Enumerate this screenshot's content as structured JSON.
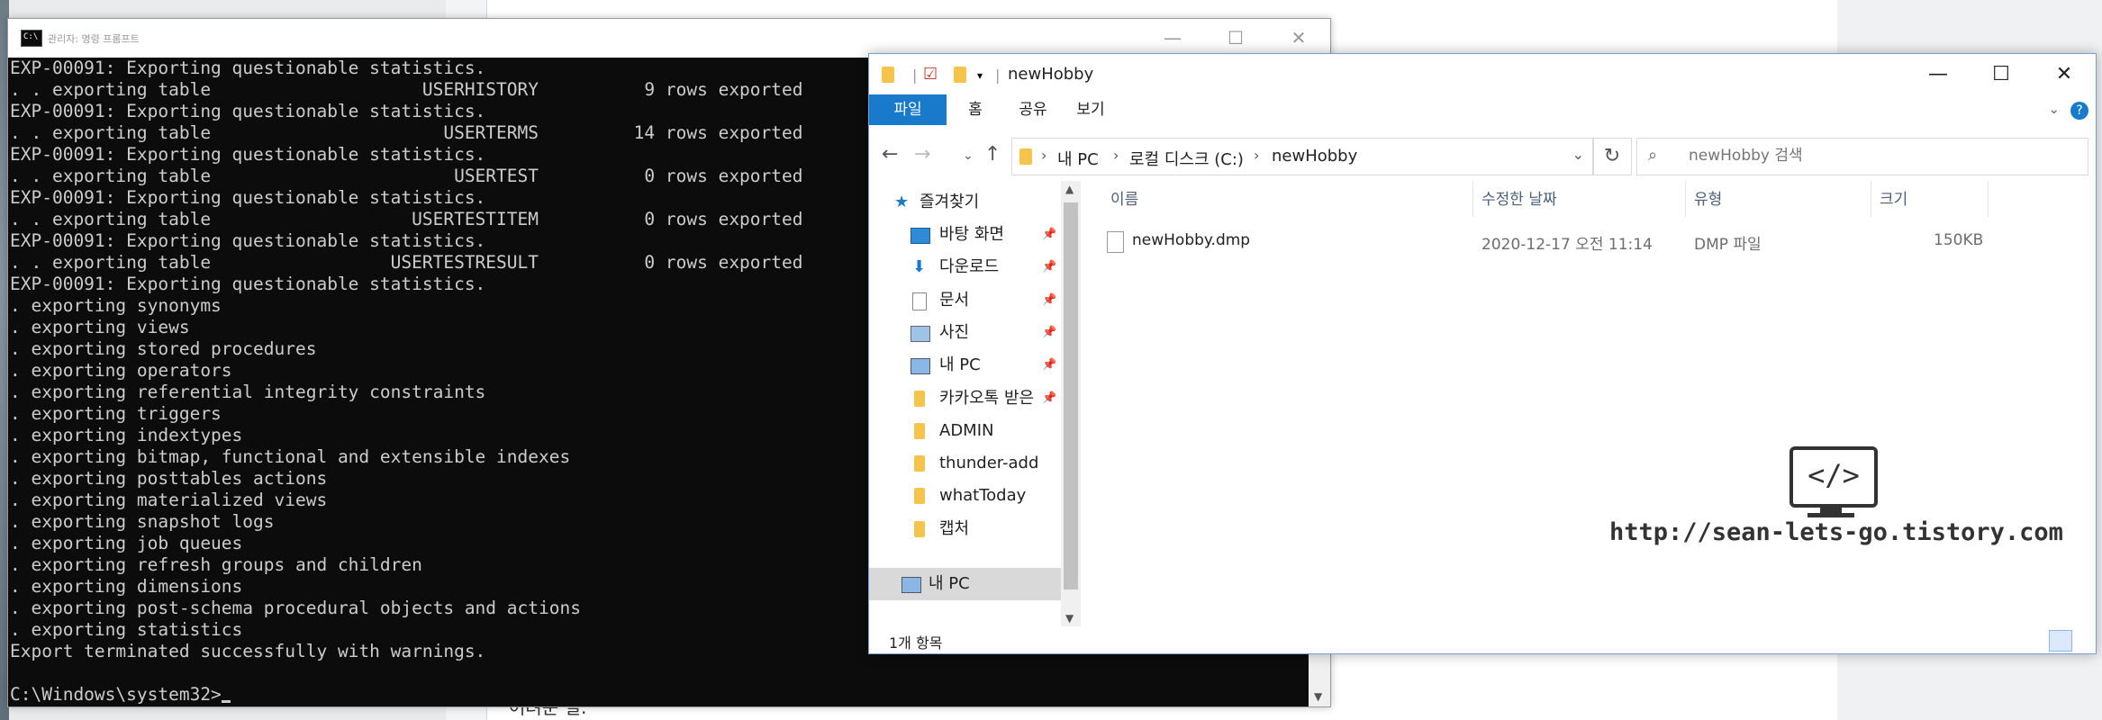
{
  "background": {
    "partial_text": "어려운 일."
  },
  "console": {
    "title": "관리자: 명령 프롬프트",
    "icon_label": "C:\\",
    "lines": [
      "EXP-00091: Exporting questionable statistics.",
      ". . exporting table                    USERHISTORY          9 rows exported",
      "EXP-00091: Exporting questionable statistics.",
      ". . exporting table                      USERTERMS         14 rows exported",
      "EXP-00091: Exporting questionable statistics.",
      ". . exporting table                       USERTEST          0 rows exported",
      "EXP-00091: Exporting questionable statistics.",
      ". . exporting table                   USERTESTITEM          0 rows exported",
      "EXP-00091: Exporting questionable statistics.",
      ". . exporting table                 USERTESTRESULT          0 rows exported",
      "EXP-00091: Exporting questionable statistics.",
      ". exporting synonyms",
      ". exporting views",
      ". exporting stored procedures",
      ". exporting operators",
      ". exporting referential integrity constraints",
      ". exporting triggers",
      ". exporting indextypes",
      ". exporting bitmap, functional and extensible indexes",
      ". exporting posttables actions",
      ". exporting materialized views",
      ". exporting snapshot logs",
      ". exporting job queues",
      ". exporting refresh groups and children",
      ". exporting dimensions",
      ". exporting post-schema procedural objects and actions",
      ". exporting statistics",
      "Export terminated successfully with warnings.",
      ""
    ],
    "prompt": "C:\\Windows\\system32>"
  },
  "explorer": {
    "title": "newHobby",
    "tabs": [
      "파일",
      "홈",
      "공유",
      "보기"
    ],
    "address": [
      "내 PC",
      "로컬 디스크 (C:)",
      "newHobby"
    ],
    "search_placeholder": "newHobby 검색",
    "columns": [
      "이름",
      "수정한 날짜",
      "유형",
      "크기"
    ],
    "nav": {
      "quick_access": "즐겨찾기",
      "items": [
        {
          "label": "바탕 화면",
          "icon": "desktop-icon",
          "pinned": true
        },
        {
          "label": "다운로드",
          "icon": "download-icon",
          "pinned": true
        },
        {
          "label": "문서",
          "icon": "document-icon",
          "pinned": true
        },
        {
          "label": "사진",
          "icon": "picture-icon",
          "pinned": true
        },
        {
          "label": "내 PC",
          "icon": "pc-icon",
          "pinned": true
        },
        {
          "label": "카카오톡 받은",
          "icon": "folder-icon",
          "pinned": true
        },
        {
          "label": "ADMIN",
          "icon": "folder-icon",
          "pinned": false
        },
        {
          "label": "thunder-add",
          "icon": "folder-icon",
          "pinned": false
        },
        {
          "label": "whatToday",
          "icon": "folder-icon",
          "pinned": false
        },
        {
          "label": "캡처",
          "icon": "folder-icon",
          "pinned": false
        }
      ],
      "this_pc": "내 PC"
    },
    "files": [
      {
        "name": "newHobby.dmp",
        "modified": "2020-12-17 오전 11:14",
        "type": "DMP 파일",
        "size": "150KB"
      }
    ],
    "status": "1개 항목"
  },
  "watermark": {
    "glyph": "</>",
    "text": "http://sean-lets-go.tistory.com"
  },
  "colors": {
    "console_bg": "#0c0c0c",
    "console_fg": "#cccccc",
    "accent": "#1979ca",
    "folder": "#f4c54a"
  }
}
